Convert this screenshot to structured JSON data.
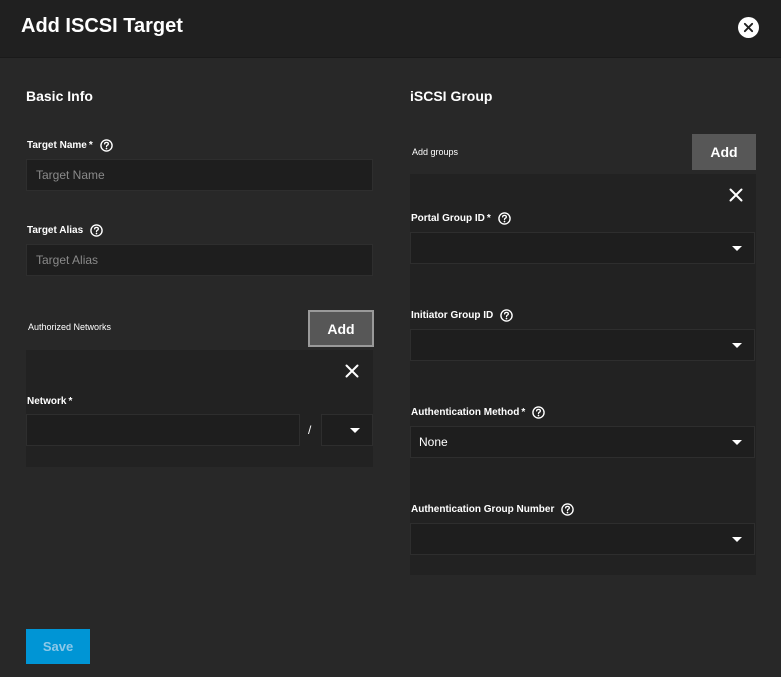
{
  "dialog": {
    "title": "Add ISCSI Target",
    "close_icon": "close-circle-icon"
  },
  "basic_info": {
    "title": "Basic Info",
    "target_name": {
      "label": "Target Name",
      "required": "*",
      "placeholder": "Target Name",
      "value": ""
    },
    "target_alias": {
      "label": "Target Alias",
      "placeholder": "Target Alias",
      "value": ""
    },
    "authorized_networks": {
      "label": "Authorized Networks",
      "add_label": "Add",
      "network": {
        "label": "Network",
        "required": "*",
        "value": "",
        "separator": "/",
        "mask_value": ""
      }
    }
  },
  "iscsi_group": {
    "title": "iSCSI Group",
    "add_groups_label": "Add groups",
    "add_label": "Add",
    "portal_group_id": {
      "label": "Portal Group ID",
      "required": "*",
      "value": ""
    },
    "initiator_group_id": {
      "label": "Initiator Group ID",
      "value": ""
    },
    "authentication_method": {
      "label": "Authentication Method",
      "required": "*",
      "value": "None"
    },
    "authentication_group_number": {
      "label": "Authentication Group Number",
      "value": ""
    }
  },
  "footer": {
    "save_label": "Save"
  },
  "colors": {
    "accent": "#0095d5",
    "background": "#282828",
    "header": "#202020"
  }
}
